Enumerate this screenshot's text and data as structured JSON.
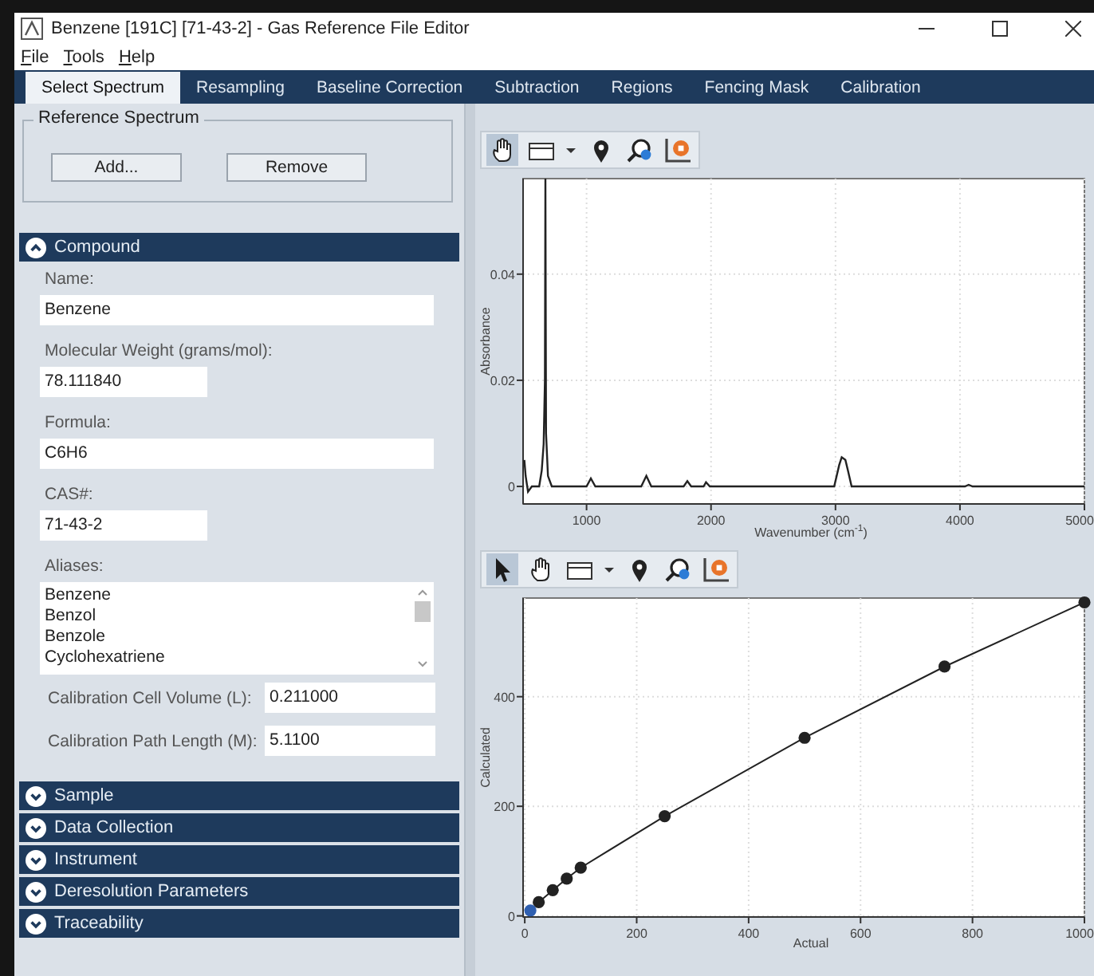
{
  "window": {
    "title": "Benzene [191C] [71-43-2] - Gas Reference File Editor"
  },
  "menu": [
    "File",
    "Tools",
    "Help"
  ],
  "tabs": [
    {
      "label": "Select Spectrum",
      "selected": true
    },
    {
      "label": "Resampling",
      "selected": false
    },
    {
      "label": "Baseline Correction",
      "selected": false
    },
    {
      "label": "Subtraction",
      "selected": false
    },
    {
      "label": "Regions",
      "selected": false
    },
    {
      "label": "Fencing Mask",
      "selected": false
    },
    {
      "label": "Calibration",
      "selected": false
    }
  ],
  "reference_spectrum": {
    "title": "Reference Spectrum",
    "buttons": [
      "Add...",
      "Remove"
    ]
  },
  "sections": [
    {
      "title": "Compound",
      "expanded": true,
      "fields": [
        {
          "kind": "long",
          "label": "Name:",
          "value": "Benzene"
        },
        {
          "kind": "short",
          "label": "Molecular Weight (grams/mol):",
          "value": "78.111840"
        },
        {
          "kind": "long",
          "label": "Formula:",
          "value": "C6H6"
        },
        {
          "kind": "short",
          "label": "CAS#:",
          "value": "71-43-2"
        },
        {
          "kind": "list",
          "label": "Aliases:",
          "items": [
            "Benzene",
            "Benzol",
            "Benzole",
            "Cyclohexatriene"
          ]
        },
        {
          "kind": "inline",
          "label": "Calibration Cell Volume (L):",
          "value": "0.211000"
        },
        {
          "kind": "inline",
          "label": "Calibration Path Length (M):",
          "value": "5.1100"
        }
      ]
    },
    {
      "title": "Sample",
      "expanded": false
    },
    {
      "title": "Data Collection",
      "expanded": false
    },
    {
      "title": "Instrument",
      "expanded": false
    },
    {
      "title": "Deresolution Parameters",
      "expanded": false
    },
    {
      "title": "Traceability",
      "expanded": false
    }
  ],
  "plots": [
    {
      "tools": [
        {
          "kind": "hand",
          "selected": true
        },
        {
          "kind": "rectangle",
          "selected": false
        },
        {
          "kind": "dropdown",
          "selected": false
        },
        {
          "kind": "pin",
          "selected": false
        },
        {
          "kind": "zoom",
          "selected": false
        },
        {
          "kind": "reset",
          "selected": false
        }
      ],
      "chart_data": {
        "type": "line",
        "xlabel": "Wavenumber (cm$^{-1}$)",
        "ylabel": "Absorbance",
        "x": [
          500,
          510,
          530,
          560,
          620,
          640,
          655,
          665,
          670,
          675,
          690,
          720,
          1000,
          1035,
          1070,
          1440,
          1480,
          1520,
          1780,
          1810,
          1840,
          1940,
          1960,
          1990,
          2990,
          3030,
          3050,
          3080,
          3100,
          3130,
          4040,
          4070,
          4100,
          5000
        ],
        "series": [
          {
            "color": "#222222",
            "values": [
              0.005,
              0.002,
              -0.001,
              0,
              0,
              0.003,
              0.008,
              0.02,
              0.058,
              0.01,
              0.002,
              0,
              0,
              0.0015,
              0,
              0,
              0.002,
              0,
              0,
              0.001,
              0,
              0,
              0.0008,
              0,
              0,
              0.004,
              0.0055,
              0.005,
              0.003,
              0,
              0,
              0.0003,
              0,
              0
            ]
          }
        ],
        "grid": true,
        "xlim": [
          490,
          5000
        ],
        "ylim": [
          -0.0033,
          0.058
        ],
        "xticks": [
          1000,
          2000,
          3000,
          4000,
          5000
        ],
        "yticks": [
          0,
          0.02,
          0.04
        ]
      }
    },
    {
      "tools": [
        {
          "kind": "pointer",
          "selected": true
        },
        {
          "kind": "hand",
          "selected": false
        },
        {
          "kind": "rectangle",
          "selected": false
        },
        {
          "kind": "dropdown",
          "selected": false
        },
        {
          "kind": "pin",
          "selected": false
        },
        {
          "kind": "zoom",
          "selected": false
        },
        {
          "kind": "reset",
          "selected": false
        }
      ],
      "chart_data": {
        "type": "line",
        "grid": true,
        "xlabel": "Actual",
        "ylabel": "Calculated",
        "x": [
          10,
          25,
          50,
          75,
          100,
          250,
          500,
          750,
          1000
        ],
        "series": [
          {
            "color": "#222222",
            "marker": "circle",
            "values": [
              null,
              25,
              47,
              68,
              88,
              182,
              325,
              455,
              572
            ]
          },
          {
            "color": "#2f5fb0",
            "marker": "circle",
            "values": [
              10,
              null,
              null,
              null,
              null,
              null,
              null,
              null,
              null
            ]
          }
        ],
        "xlim": [
          -3,
          1000
        ],
        "ylim": [
          -2,
          580
        ],
        "xticks": [
          0,
          200,
          400,
          600,
          800,
          1000
        ],
        "yticks": [
          0,
          200,
          400
        ]
      }
    }
  ]
}
